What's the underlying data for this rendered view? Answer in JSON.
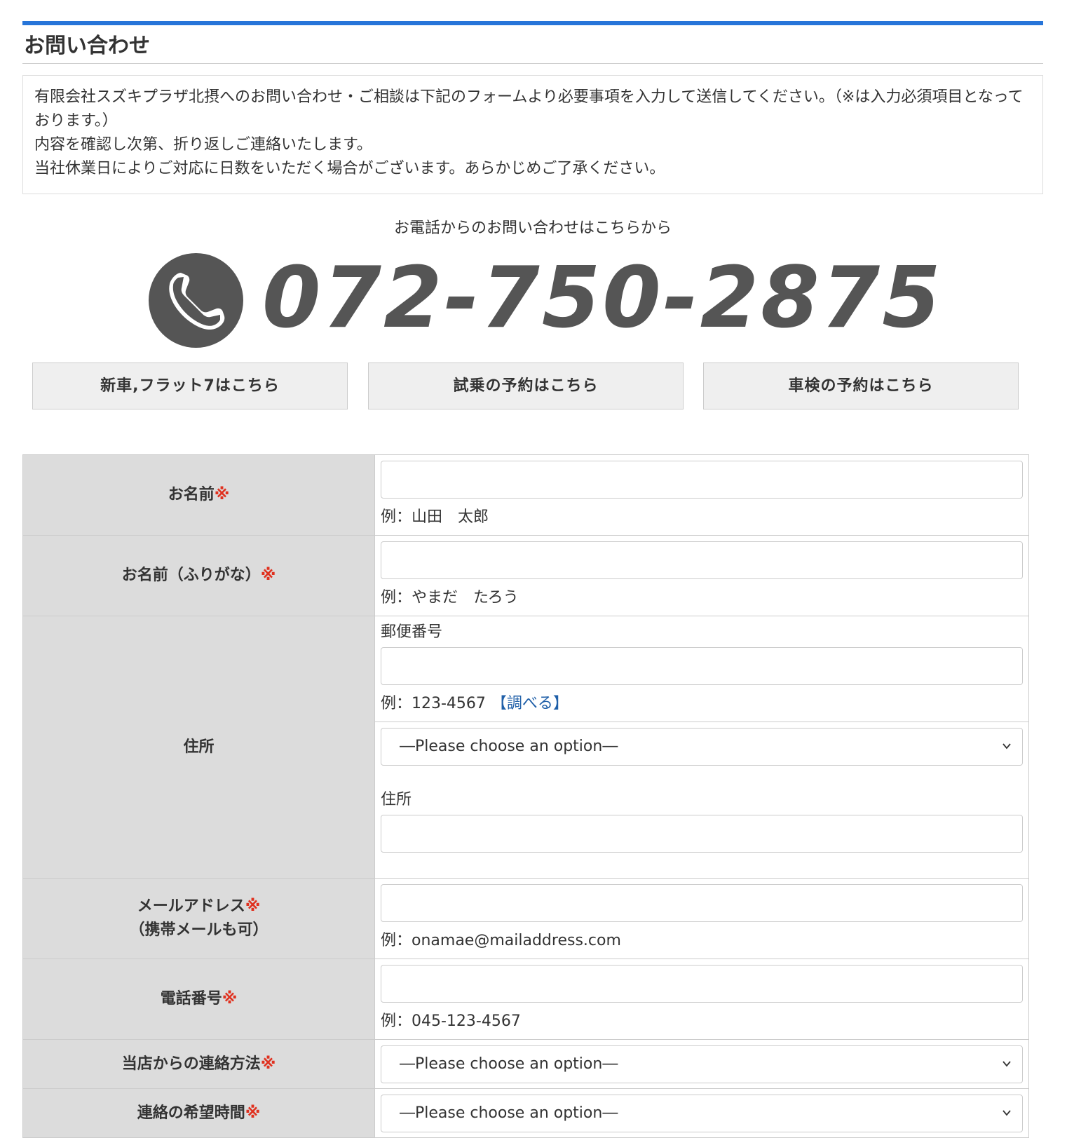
{
  "page": {
    "title": "お問い合わせ"
  },
  "intro": {
    "line1": "有限会社スズキプラザ北摂へのお問い合わせ・ご相談は下記のフォームより必要事項を入力して送信してください。（※は入力必須項目となっております。）",
    "line2": "内容を確認し次第、折り返しご連絡いたします。",
    "line3": "当社休業日によりご対応に日数をいただく場合がございます。あらかじめご了承ください。"
  },
  "tel": {
    "caption": "お電話からのお問い合わせはこちらから",
    "number": "072-750-2875",
    "icon": "phone-icon"
  },
  "buttons": {
    "new_car": "新車,フラット7はこちら",
    "test_drive": "試乗の予約はこちら",
    "inspection": "車検の予約はこちら"
  },
  "form": {
    "required_mark": "※",
    "name": {
      "label": "お名前",
      "hint": "例：山田　太郎"
    },
    "furigana": {
      "label": "お名前（ふりがな）",
      "hint": "例：やまだ　たろう"
    },
    "address": {
      "label": "住所",
      "postal_label": "郵便番号",
      "postal_hint": "例：123-4567",
      "lookup_link": "【調べる】",
      "prefecture_select": "―Please choose an option―",
      "address_label": "住所"
    },
    "email": {
      "label": "メールアドレス",
      "label2": "（携帯メールも可）",
      "hint": "例：onamae@mailaddress.com"
    },
    "phone": {
      "label": "電話番号",
      "hint": "例：045-123-4567"
    },
    "contact_method": {
      "label": "当店からの連絡方法",
      "select": "―Please choose an option―"
    },
    "contact_time": {
      "label": "連絡の希望時間",
      "select": "―Please choose an option―"
    }
  },
  "colors": {
    "accent": "#2775d9",
    "required": "#e0301e",
    "header_bg": "#dcdcdc",
    "button_bg": "#efefef",
    "link": "#1f5fa8",
    "tel": "#555555"
  }
}
